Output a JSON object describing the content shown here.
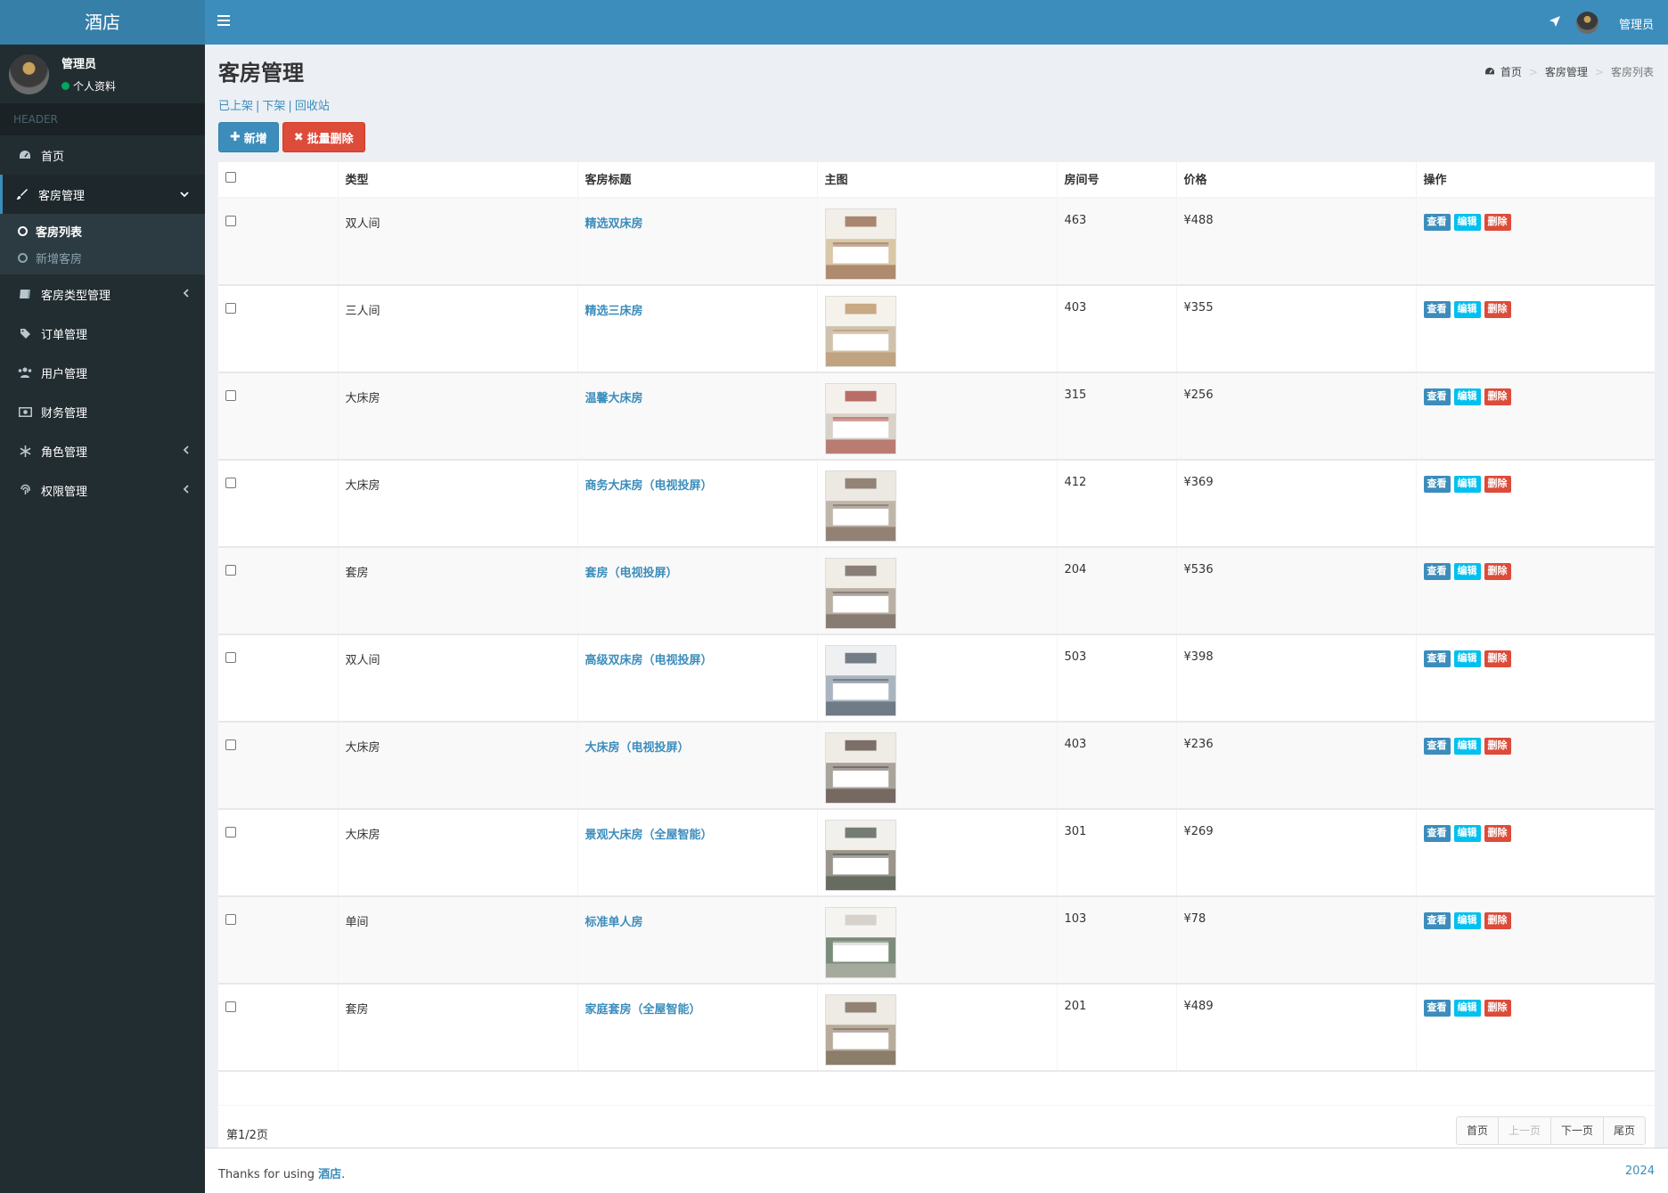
{
  "app": {
    "logo": "酒店"
  },
  "user": {
    "name": "管理员",
    "status": "个人资料"
  },
  "sidebar": {
    "header": "HEADER",
    "items": [
      {
        "label": "首页",
        "icon": "dashboard-icon"
      },
      {
        "label": "客房管理",
        "icon": "brush-icon",
        "submenu": [
          {
            "label": "客房列表"
          },
          {
            "label": "新增客房"
          }
        ]
      },
      {
        "label": "客房类型管理",
        "icon": "book-icon"
      },
      {
        "label": "订单管理",
        "icon": "tag-icon"
      },
      {
        "label": "用户管理",
        "icon": "users-icon"
      },
      {
        "label": "财务管理",
        "icon": "money-icon"
      },
      {
        "label": "角色管理",
        "icon": "snowflake-icon"
      },
      {
        "label": "权限管理",
        "icon": "fingerprint-icon"
      }
    ]
  },
  "topbar": {
    "user_name": "管理员"
  },
  "page": {
    "title": "客房管理",
    "breadcrumb": [
      "首页",
      "客房管理",
      "客房列表"
    ],
    "links": [
      "已上架",
      "下架",
      "回收站"
    ],
    "btn_add": "新增",
    "btn_batch_delete": "批量删除"
  },
  "table": {
    "headers": [
      "类型",
      "客房标题",
      "主图",
      "房间号",
      "价格",
      "操作"
    ],
    "ops": {
      "view": "查看",
      "edit": "编辑",
      "delete": "删除"
    },
    "rows": [
      {
        "type": "双人间",
        "title": "精选双床房",
        "room": "463",
        "price": "¥488"
      },
      {
        "type": "三人间",
        "title": "精选三床房",
        "room": "403",
        "price": "¥355"
      },
      {
        "type": "大床房",
        "title": "温馨大床房",
        "room": "315",
        "price": "¥256"
      },
      {
        "type": "大床房",
        "title": "商务大床房（电视投屏）",
        "room": "412",
        "price": "¥369"
      },
      {
        "type": "套房",
        "title": "套房（电视投屏）",
        "room": "204",
        "price": "¥536"
      },
      {
        "type": "双人间",
        "title": "高级双床房（电视投屏）",
        "room": "503",
        "price": "¥398"
      },
      {
        "type": "大床房",
        "title": "大床房（电视投屏）",
        "room": "403",
        "price": "¥236"
      },
      {
        "type": "大床房",
        "title": "景观大床房（全屋智能）",
        "room": "301",
        "price": "¥269"
      },
      {
        "type": "单间",
        "title": "标准单人房",
        "room": "103",
        "price": "¥78"
      },
      {
        "type": "套房",
        "title": "家庭套房（全屋智能）",
        "room": "201",
        "price": "¥489"
      }
    ]
  },
  "pagination": {
    "info": "第1/2页",
    "first": "首页",
    "prev": "上一页",
    "next": "下一页",
    "last": "尾页"
  },
  "footer": {
    "prefix": "Thanks for using ",
    "brand": "酒店",
    "suffix": ".",
    "year": "2024"
  },
  "colors": {
    "primary": "#3c8dbc",
    "danger": "#dd4b39",
    "info": "#00c0ef",
    "sidebar": "#222d32"
  }
}
